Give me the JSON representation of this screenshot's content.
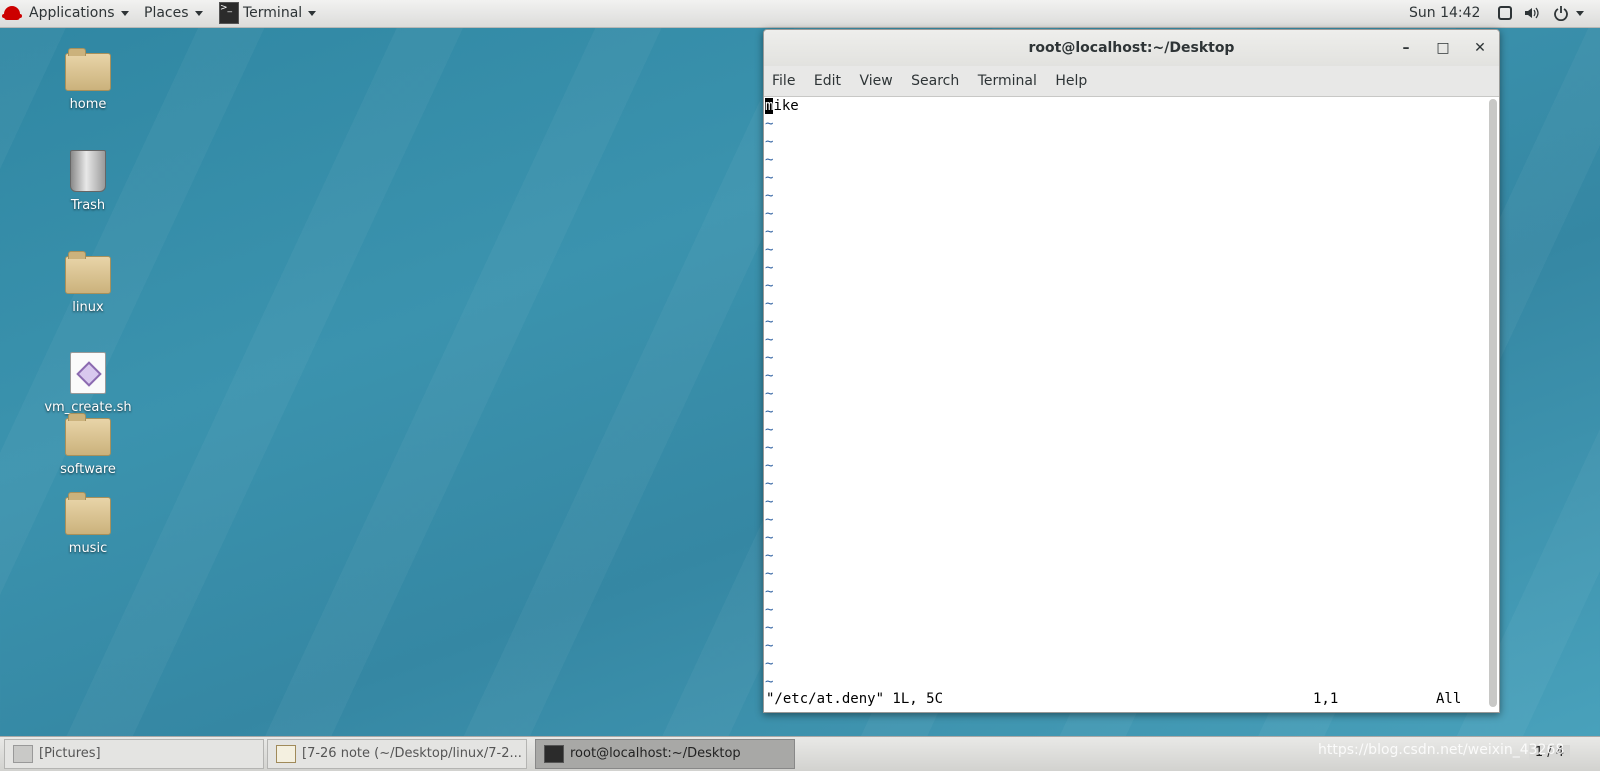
{
  "topbar": {
    "applications": "Applications",
    "places": "Places",
    "terminal": "Terminal",
    "clock": "Sun 14:42"
  },
  "desktop": {
    "icons": [
      "home",
      "Trash",
      "linux",
      "vm_create.sh",
      "software",
      "music"
    ]
  },
  "window": {
    "title": "root@localhost:~/Desktop",
    "menu": [
      "File",
      "Edit",
      "View",
      "Search",
      "Terminal",
      "Help"
    ],
    "first_line_cursor": "m",
    "first_line_rest": "ike",
    "tilde": "~",
    "status_file": "\"/etc/at.deny\" 1L, 5C",
    "status_pos": "1,1",
    "status_scroll": "All"
  },
  "taskbar": {
    "tasks": [
      "[Pictures]",
      "[7-26 note (~/Desktop/linux/7-2...",
      "root@localhost:~/Desktop"
    ],
    "pager": "1 / 4"
  },
  "watermark": "https://blog.csdn.net/weixin_43268"
}
